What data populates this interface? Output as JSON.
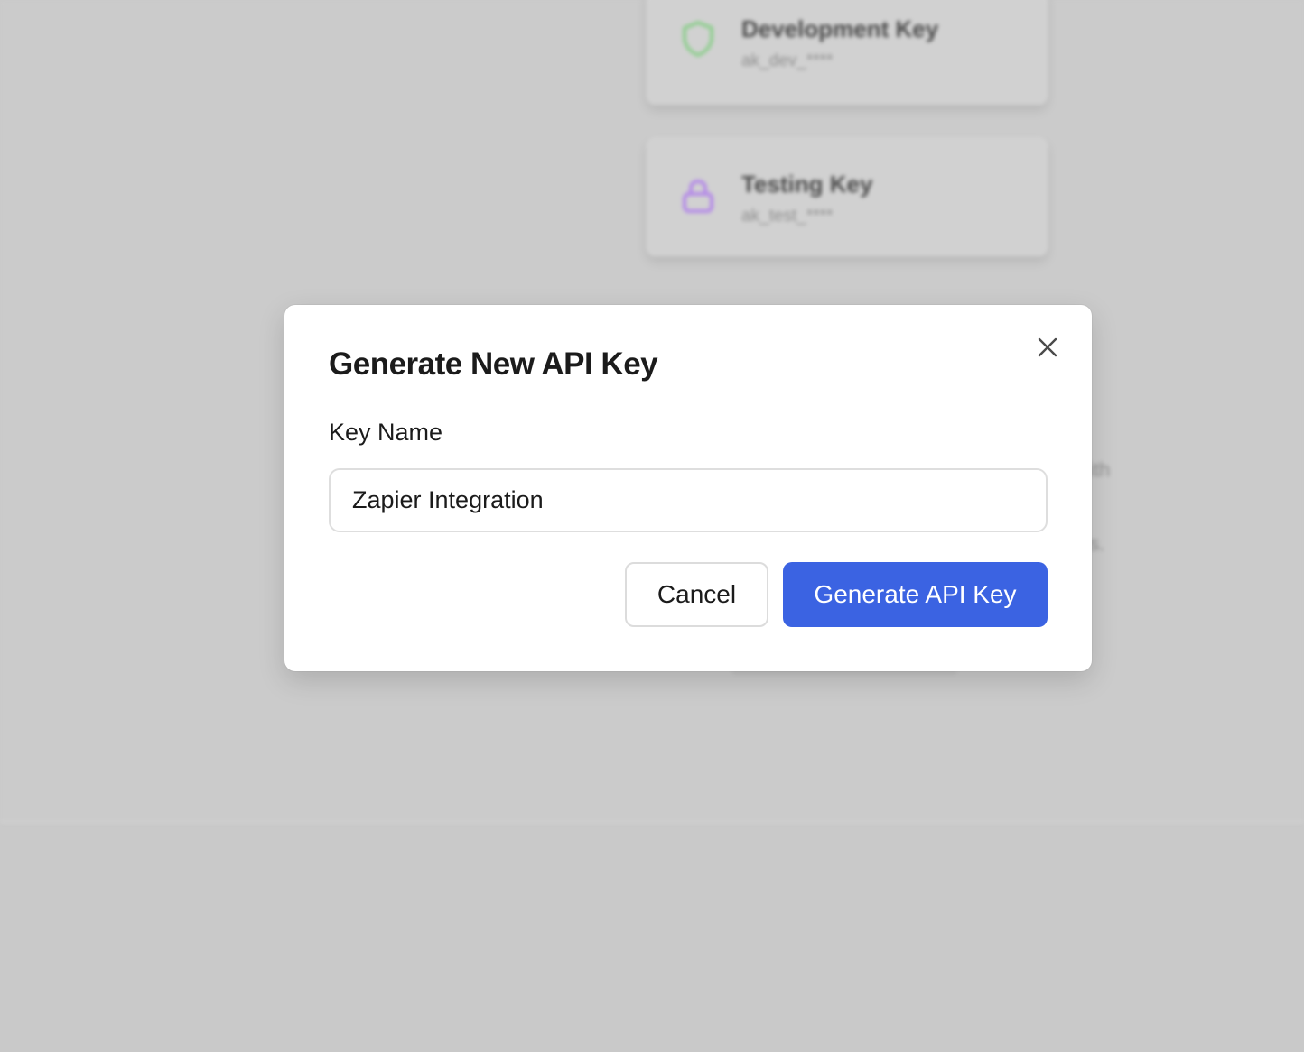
{
  "background": {
    "key_cards": [
      {
        "title": "Development Key",
        "subtitle": "ak_dev_****",
        "icon": "shield-icon",
        "icon_color": "#8fce8f"
      },
      {
        "title": "Testing Key",
        "subtitle": "ak_test_****",
        "icon": "lock-icon",
        "icon_color": "#b489e8"
      }
    ],
    "fragments": [
      "ith",
      "s."
    ]
  },
  "modal": {
    "title": "Generate New API Key",
    "close_icon": "close-icon",
    "field_label": "Key Name",
    "key_name_value": "Zapier Integration",
    "cancel_label": "Cancel",
    "generate_label": "Generate API Key"
  },
  "colors": {
    "primary": "#3b63e2",
    "overlay": "#c9c9c9"
  }
}
